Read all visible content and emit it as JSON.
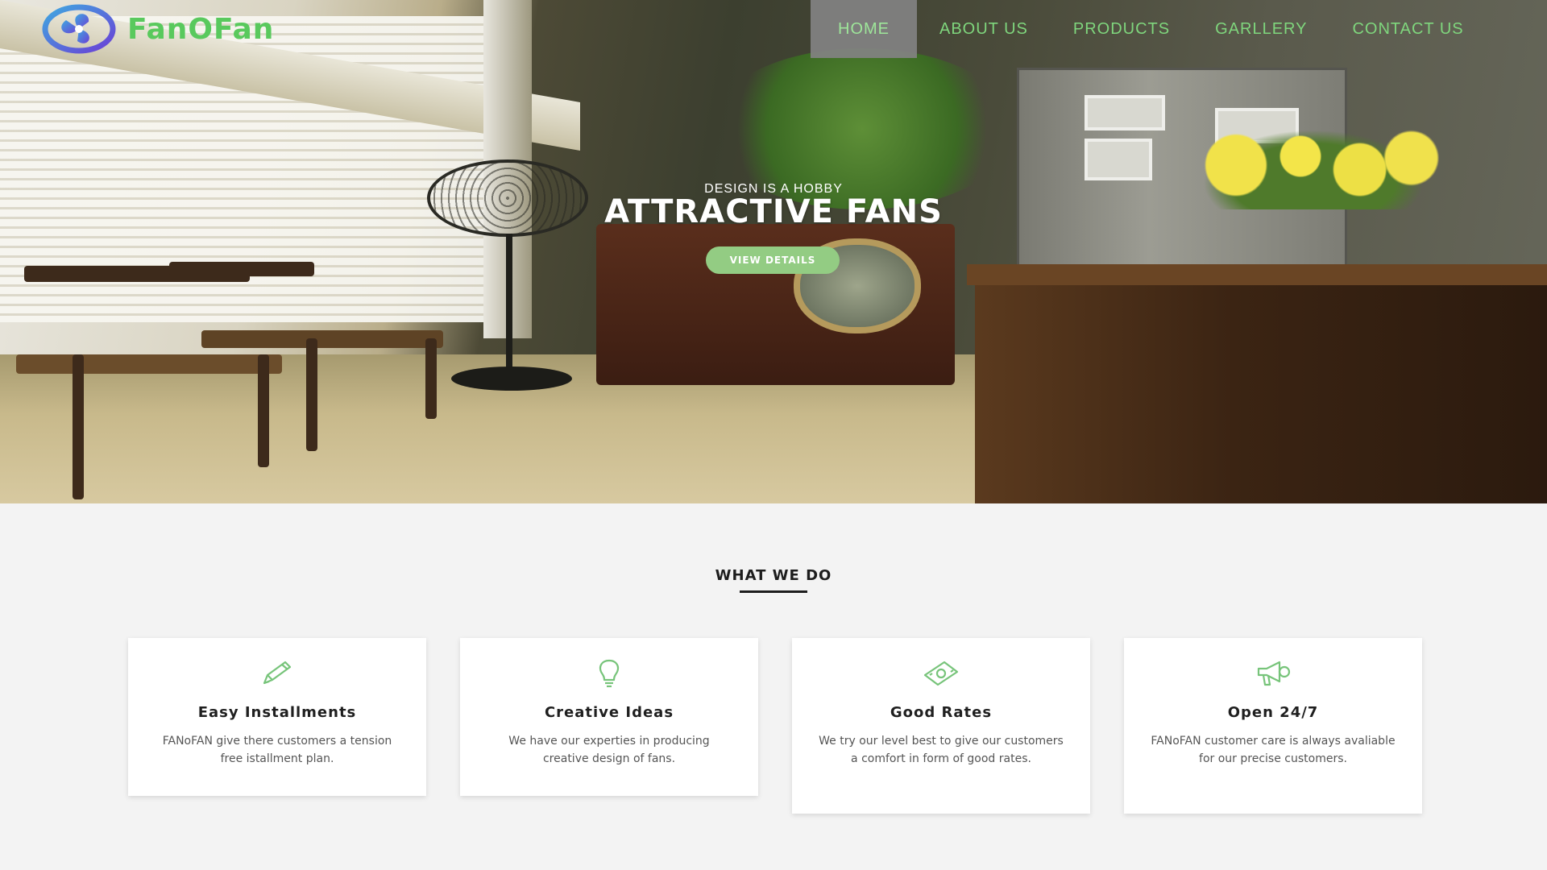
{
  "brand": {
    "name": "FanOFan",
    "accent_color": "#59c95d",
    "logo_icon": "fan-logo-icon"
  },
  "nav": {
    "items": [
      {
        "label": "HOME",
        "active": true
      },
      {
        "label": "ABOUT US",
        "active": false
      },
      {
        "label": "PRODUCTS",
        "active": false
      },
      {
        "label": "GARLLERY",
        "active": false
      },
      {
        "label": "CONTACT US",
        "active": false
      }
    ]
  },
  "hero": {
    "kicker": "DESIGN IS A HOBBY",
    "title": "ATTRACTIVE FANS",
    "button_label": "VIEW DETAILS",
    "button_color": "#93cc83"
  },
  "section": {
    "title": "WHAT WE DO",
    "cards": [
      {
        "icon": "pencil-icon",
        "title": "Easy Installments",
        "text": "FANoFAN give there customers a tension free istallment plan."
      },
      {
        "icon": "lightbulb-icon",
        "title": "Creative Ideas",
        "text": "We have our experties in producing creative design of fans."
      },
      {
        "icon": "money-icon",
        "title": "Good Rates",
        "text": "We try our level best to give our customers a comfort in form of good rates."
      },
      {
        "icon": "megaphone-icon",
        "title": "Open 24/7",
        "text": "FANoFAN customer care is always avaliable for our precise customers."
      }
    ]
  }
}
